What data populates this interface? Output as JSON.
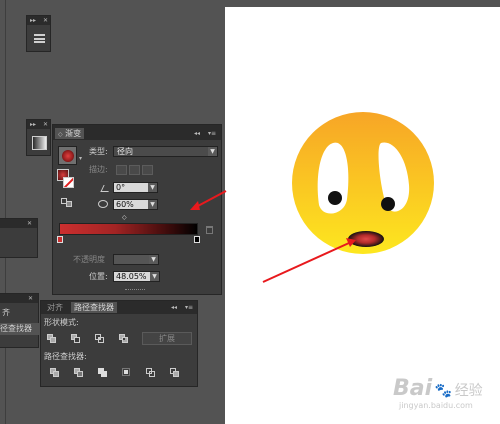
{
  "gradient_panel": {
    "tab_label": "渐变",
    "type_label": "类型:",
    "type_value": "径向",
    "stroke_label": "描边:",
    "angle_value": "0°",
    "aspect_value": "60%",
    "opacity_label": "不透明度",
    "position_label": "位置:",
    "position_value": "48.05%"
  },
  "pathfinder_panel": {
    "tabs": [
      "对齐",
      "路径查找器"
    ],
    "shape_modes_label": "形状模式:",
    "expand_label": "扩展",
    "pathfinders_label": "路径查找器:"
  },
  "left_partial_panel": {
    "item_1": "齐",
    "item_2": "径查找器"
  },
  "colors": {
    "workspace": "#535353",
    "panel": "#3c3c3c",
    "canvas": "#ffffff",
    "gradient_start": "#cc2f2f",
    "gradient_end": "#000000",
    "emoji_top": "#f7a526",
    "emoji_bottom": "#fde71f",
    "arrow": "#e8191d"
  },
  "watermark": {
    "brand": "Bai",
    "brand_suffix": "经验",
    "url": "jingyan.baidu.com"
  }
}
